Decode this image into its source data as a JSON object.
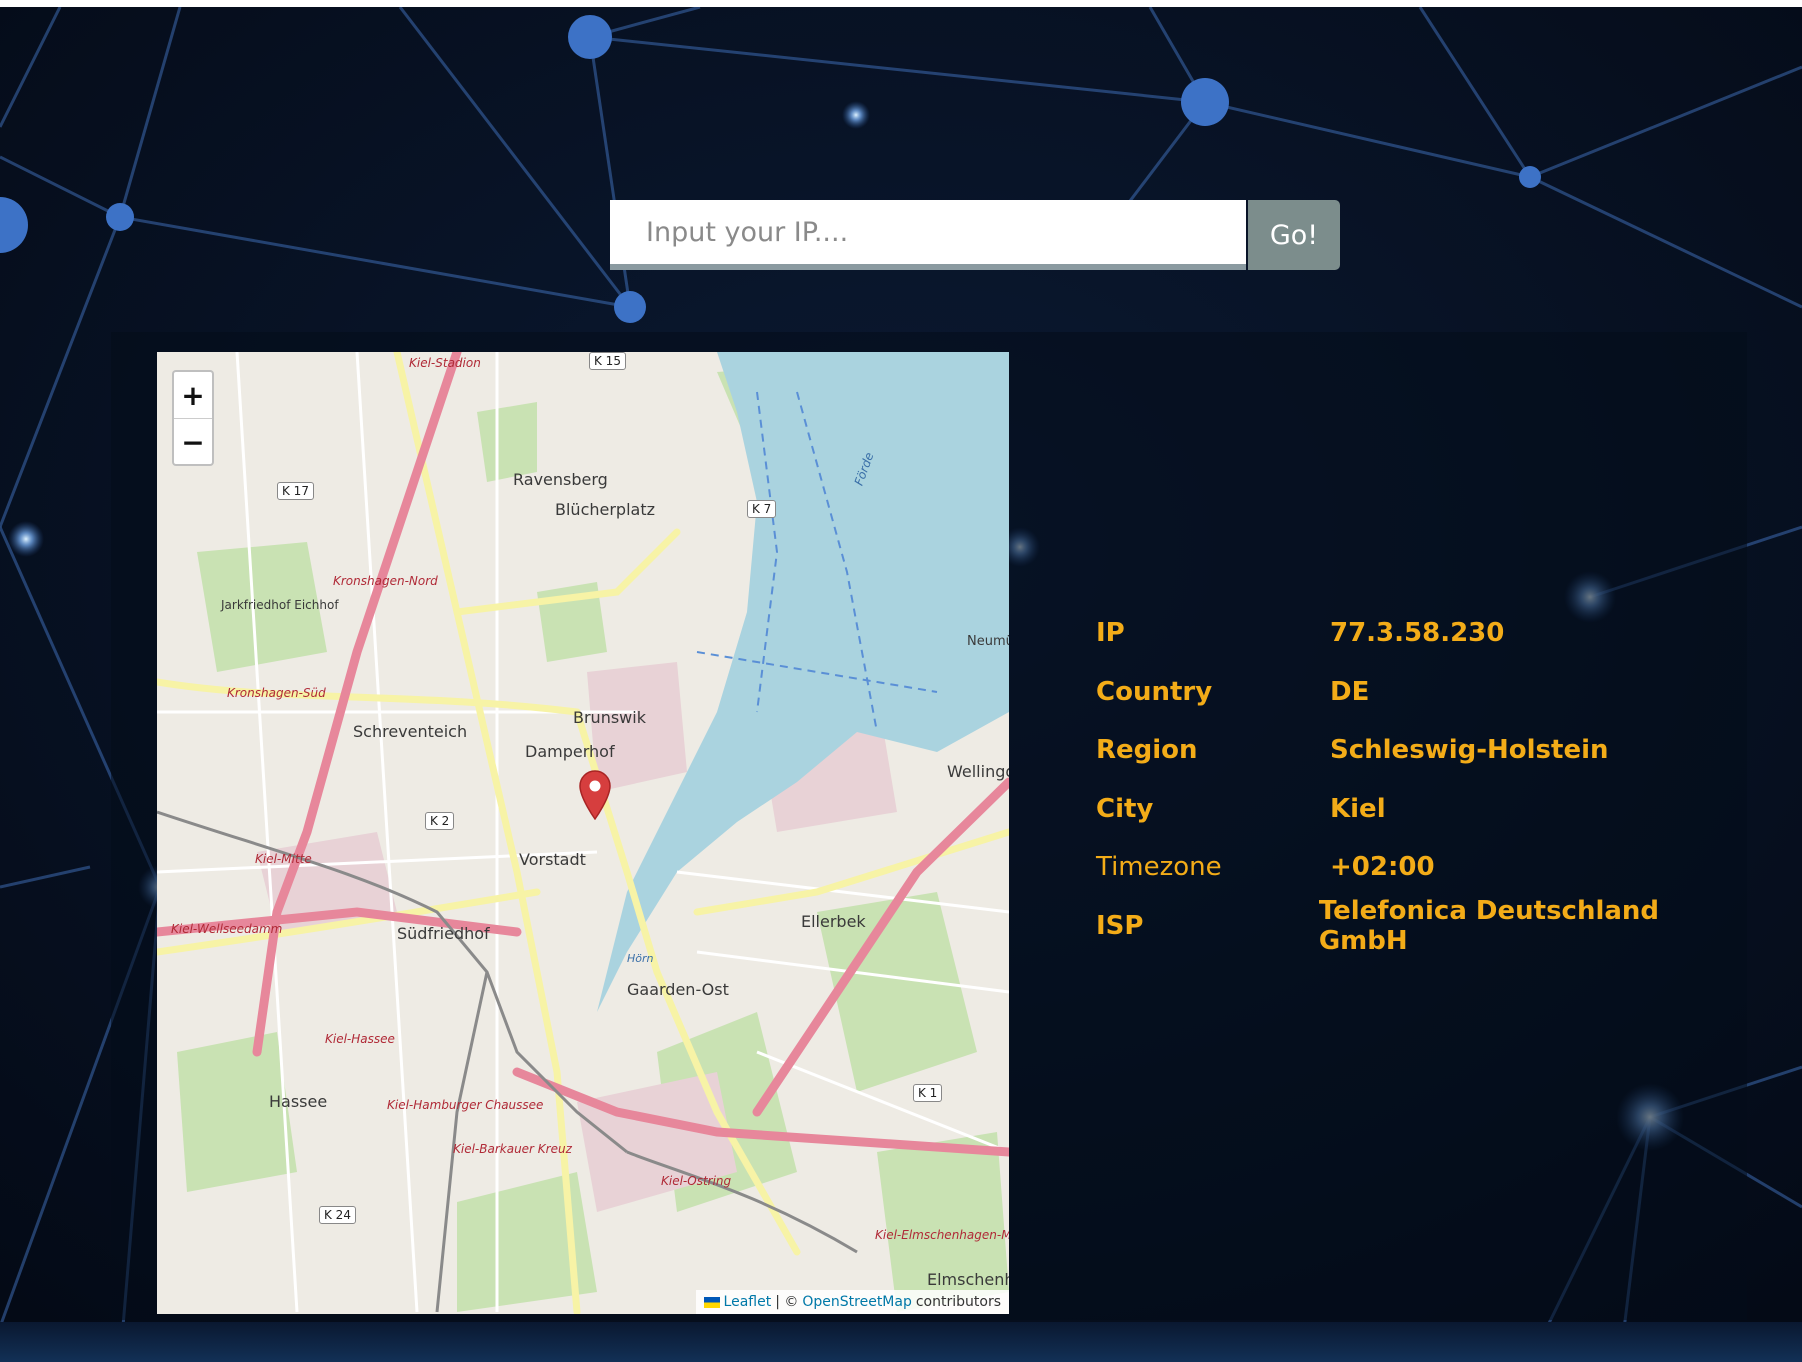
{
  "search": {
    "placeholder": "Input your IP....",
    "button_label": "Go!"
  },
  "map": {
    "zoom_in_label": "+",
    "zoom_out_label": "−",
    "attribution": {
      "leaflet": "Leaflet",
      "separator": "| ©",
      "osm": "OpenStreetMap",
      "contributors": "contributors"
    },
    "marker_icon": "map-pin-icon",
    "places": [
      "Ravensberg",
      "Blücherplatz",
      "Schreventeich",
      "Damperhof",
      "Brunswik",
      "Vorstadt",
      "Südfriedhof",
      "Gaarden-Ost",
      "Ellerbek",
      "Hassee",
      "Wellingdorf",
      "Elmschenhagen",
      "Neumühlen-Dietrichsdorf",
      "Jarkfriedhof Eichhof"
    ],
    "stations": [
      "Kiel-Stadion",
      "Kronshagen-Nord",
      "Kronshagen-Süd",
      "Kiel-Mitte",
      "Kiel-Wellseedamm",
      "Kiel-Hassee",
      "Kiel-Hamburger Chaussee",
      "Kiel-Barkauer Kreuz",
      "Kiel-Elmschenhagen-Mitte",
      "Kiel-Ostring"
    ],
    "shields": [
      "K 17",
      "K 7",
      "K 2",
      "K 1",
      "K 24",
      "K 15"
    ],
    "water": [
      "Förde",
      "Hörn"
    ]
  },
  "info": {
    "rows": [
      {
        "key": "IP",
        "value": "77.3.58.230"
      },
      {
        "key": "Country",
        "value": "DE"
      },
      {
        "key": "Region",
        "value": "Schleswig-Holstein"
      },
      {
        "key": "City",
        "value": "Kiel"
      },
      {
        "key": "Timezone",
        "value": "+02:00"
      },
      {
        "key": "ISP",
        "value": "Telefonica Deutschland GmbH"
      }
    ]
  },
  "colors": {
    "background": "#050d1c",
    "accent_text": "#f3ac18",
    "button": "#7c8d8c",
    "network_line": "#4a7fd0",
    "water": "#aad3df",
    "motorway": "#e7879b",
    "marker": "#d63e3e"
  }
}
